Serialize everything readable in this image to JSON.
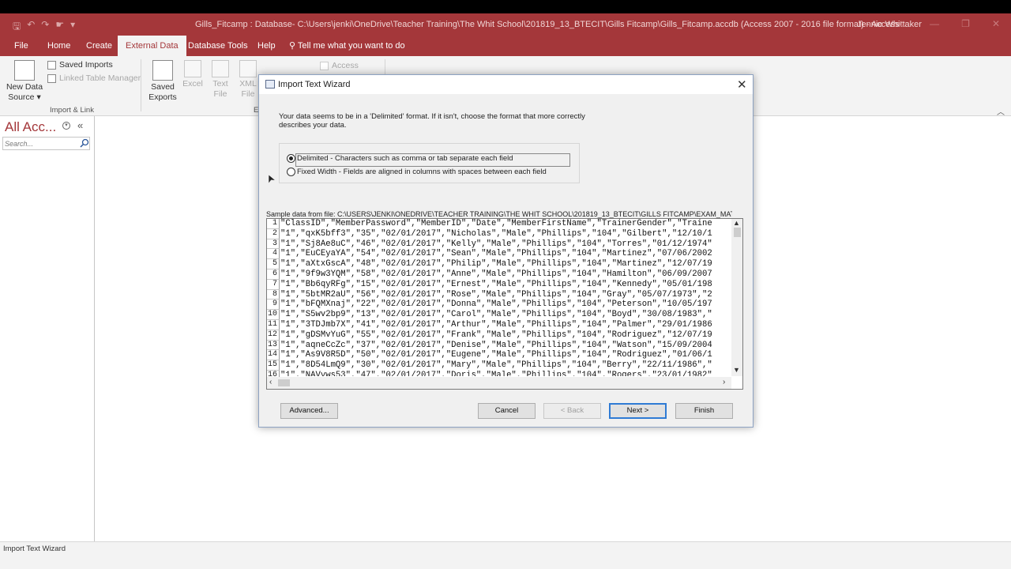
{
  "window": {
    "title": "Gills_Fitcamp : Database- C:\\Users\\jenki\\OneDrive\\Teacher Training\\The Whit School\\201819_13_BTECIT\\Gills Fitcamp\\Gills_Fitcamp.accdb (Access 2007 - 2016 file format)  -  Access",
    "user": "Jennie Whittaker"
  },
  "ribbon_tabs": [
    {
      "label": "File"
    },
    {
      "label": "Home"
    },
    {
      "label": "Create"
    },
    {
      "label": "External Data"
    },
    {
      "label": "Database Tools"
    },
    {
      "label": "Help"
    }
  ],
  "tell_me": "Tell me what you want to do",
  "ribbon": {
    "new_data_source": "New Data",
    "new_data_source_2": "Source",
    "saved_imports": "Saved Imports",
    "linked_table_manager": "Linked Table Manager",
    "group_import_link": "Import & Link",
    "saved_exports": "Saved",
    "saved_exports_2": "Exports",
    "excel": "Excel",
    "text_file": "Text",
    "text_file_2": "File",
    "xml_file": "XML",
    "xml_file_2": "File",
    "access": "Access",
    "group_export_partial": "E"
  },
  "nav": {
    "title": "All Acc...",
    "search_placeholder": "Search..."
  },
  "status": {
    "text": "Import Text Wizard"
  },
  "dialog": {
    "title": "Import Text Wizard",
    "intro": "Your data seems to be in a 'Delimited' format. If it isn't, choose the format that more correctly describes your data.",
    "option_delimited": "Delimited - Characters such as comma or tab separate each field",
    "option_fixed": "Fixed Width - Fields are aligned in columns with spaces between each field",
    "selected_option": "delimited",
    "sample_label": "Sample data from file: C:\\USERS\\JENKI\\ONEDRIVE\\TEACHER TRAINING\\THE WHIT SCHOOL\\201819_13_BTECIT\\GILLS FITCAMP\\EXAM_MATERIA",
    "rows": [
      {
        "n": "1",
        "text": "\"ClassID\",\"MemberPassword\",\"MemberID\",\"Date\",\"MemberFirstName\",\"TrainerGender\",\"Traine"
      },
      {
        "n": "2",
        "text": "\"1\",\"qxK5bff3\",\"35\",\"02/01/2017\",\"Nicholas\",\"Male\",\"Phillips\",\"104\",\"Gilbert\",\"12/10/1"
      },
      {
        "n": "3",
        "text": "\"1\",\"Sj8Ae8uC\",\"46\",\"02/01/2017\",\"Kelly\",\"Male\",\"Phillips\",\"104\",\"Torres\",\"01/12/1974\""
      },
      {
        "n": "4",
        "text": "\"1\",\"EuCEyaYA\",\"54\",\"02/01/2017\",\"Sean\",\"Male\",\"Phillips\",\"104\",\"Martinez\",\"07/06/2002"
      },
      {
        "n": "5",
        "text": "\"1\",\"aXtxGscA\",\"48\",\"02/01/2017\",\"Philip\",\"Male\",\"Phillips\",\"104\",\"Martinez\",\"12/07/19"
      },
      {
        "n": "6",
        "text": "\"1\",\"9f9w3YQM\",\"58\",\"02/01/2017\",\"Anne\",\"Male\",\"Phillips\",\"104\",\"Hamilton\",\"06/09/2007"
      },
      {
        "n": "7",
        "text": "\"1\",\"Bb6qyRFg\",\"15\",\"02/01/2017\",\"Ernest\",\"Male\",\"Phillips\",\"104\",\"Kennedy\",\"05/01/198"
      },
      {
        "n": "8",
        "text": "\"1\",\"5btMR2aU\",\"56\",\"02/01/2017\",\"Rose\",\"Male\",\"Phillips\",\"104\",\"Gray\",\"05/07/1973\",\"2"
      },
      {
        "n": "9",
        "text": "\"1\",\"bFQMXnaj\",\"22\",\"02/01/2017\",\"Donna\",\"Male\",\"Phillips\",\"104\",\"Peterson\",\"10/05/197"
      },
      {
        "n": "10",
        "text": "\"1\",\"S5wv2bp9\",\"13\",\"02/01/2017\",\"Carol\",\"Male\",\"Phillips\",\"104\",\"Boyd\",\"30/08/1983\",\""
      },
      {
        "n": "11",
        "text": "\"1\",\"3TDJmb7X\",\"41\",\"02/01/2017\",\"Arthur\",\"Male\",\"Phillips\",\"104\",\"Palmer\",\"29/01/1986"
      },
      {
        "n": "12",
        "text": "\"1\",\"gDSMvYuG\",\"55\",\"02/01/2017\",\"Frank\",\"Male\",\"Phillips\",\"104\",\"Rodriguez\",\"12/07/19"
      },
      {
        "n": "13",
        "text": "\"1\",\"aqneCcZc\",\"37\",\"02/01/2017\",\"Denise\",\"Male\",\"Phillips\",\"104\",\"Watson\",\"15/09/2004"
      },
      {
        "n": "14",
        "text": "\"1\",\"As9V8R5D\",\"50\",\"02/01/2017\",\"Eugene\",\"Male\",\"Phillips\",\"104\",\"Rodriguez\",\"01/06/1"
      },
      {
        "n": "15",
        "text": "\"1\",\"8D54LmQ9\",\"30\",\"02/01/2017\",\"Mary\",\"Male\",\"Phillips\",\"104\",\"Berry\",\"22/11/1986\",\""
      },
      {
        "n": "16",
        "text": "\"1\",\"NAVyws53\",\"47\",\"02/01/2017\",\"Doris\",\"Male\",\"Phillips\",\"104\",\"Rogers\",\"23/01/1982\""
      }
    ],
    "buttons": {
      "advanced": "Advanced...",
      "cancel": "Cancel",
      "back": "< Back",
      "next": "Next >",
      "finish": "Finish"
    }
  },
  "colors": {
    "accent": "#a4373a",
    "ribbon_bg": "#f3f3f3",
    "dialog_bg": "#f0f0f0"
  }
}
